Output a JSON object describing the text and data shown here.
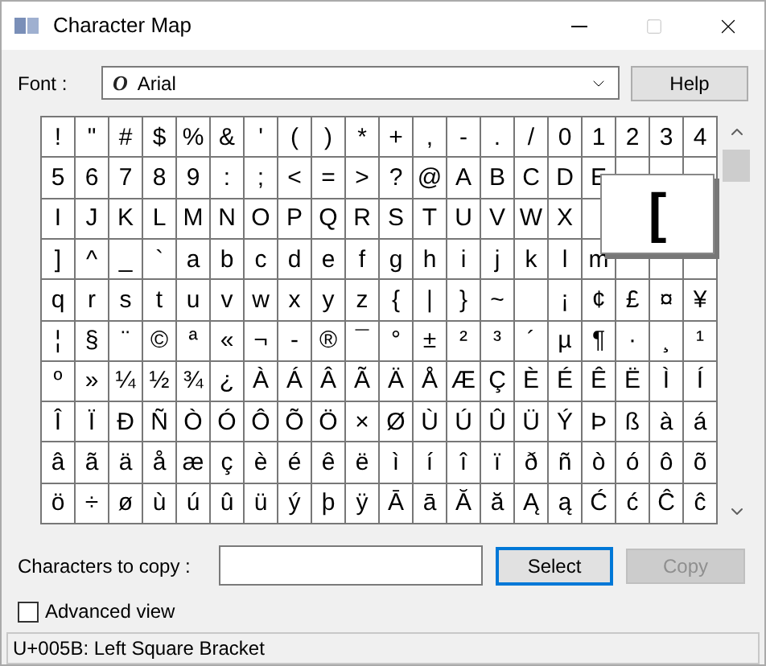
{
  "window": {
    "title": "Character Map"
  },
  "font": {
    "label": "Font :",
    "value": "Arial",
    "glyph": "O"
  },
  "help_button": "Help",
  "grid": [
    [
      "!",
      "\"",
      "#",
      "$",
      "%",
      "&",
      "'",
      "(",
      ")",
      "*",
      "+",
      ",",
      "-",
      ".",
      "/",
      "0",
      "1",
      "2",
      "3",
      "4"
    ],
    [
      "5",
      "6",
      "7",
      "8",
      "9",
      ":",
      ";",
      "<",
      "=",
      ">",
      "?",
      "@",
      "A",
      "B",
      "C",
      "D",
      "E",
      {
        "kind": "empty"
      },
      {
        "kind": "empty"
      },
      {
        "kind": "empty"
      }
    ],
    [
      "I",
      "J",
      "K",
      "L",
      "M",
      "N",
      "O",
      "P",
      "Q",
      "R",
      "S",
      "T",
      "U",
      "V",
      "W",
      "X",
      {
        "kind": "empty"
      }
    ],
    [
      "]",
      "^",
      "_",
      "`",
      "a",
      "b",
      "c",
      "d",
      "e",
      "f",
      "g",
      "h",
      "i",
      "j",
      "k",
      "l",
      "m",
      {
        "kind": "empty"
      },
      {
        "kind": "empty"
      },
      {
        "kind": "empty"
      }
    ],
    [
      "q",
      "r",
      "s",
      "t",
      "u",
      "v",
      "w",
      "x",
      "y",
      "z",
      "{",
      "|",
      "}",
      "~",
      {
        "kind": "empty"
      },
      "¡",
      "¢",
      "£",
      "¤",
      "¥"
    ],
    [
      "¦",
      "§",
      "¨",
      "©",
      "ª",
      "«",
      "¬",
      "-",
      "®",
      "¯",
      "°",
      "±",
      "²",
      "³",
      "´",
      "µ",
      "¶",
      "·",
      "¸",
      "¹"
    ],
    [
      "º",
      "»",
      "¼",
      "½",
      "¾",
      "¿",
      "À",
      "Á",
      "Â",
      "Ã",
      "Ä",
      "Å",
      "Æ",
      "Ç",
      "È",
      "É",
      "Ê",
      "Ë",
      "Ì",
      "Í"
    ],
    [
      "Î",
      "Ï",
      "Ð",
      "Ñ",
      "Ò",
      "Ó",
      "Ô",
      "Õ",
      "Ö",
      "×",
      "Ø",
      "Ù",
      "Ú",
      "Û",
      "Ü",
      "Ý",
      "Þ",
      "ß",
      "à",
      "á"
    ],
    [
      "â",
      "ã",
      "ä",
      "å",
      "æ",
      "ç",
      "è",
      "é",
      "ê",
      "ë",
      "ì",
      "í",
      "î",
      "ï",
      "ð",
      "ñ",
      "ò",
      "ó",
      "ô",
      "õ"
    ],
    [
      "ö",
      "÷",
      "ø",
      "ù",
      "ú",
      "û",
      "ü",
      "ý",
      "þ",
      "ÿ",
      "Ā",
      "ā",
      "Ă",
      "ă",
      "Ą",
      "ą",
      "Ć",
      "ć",
      "Ĉ",
      "ĉ"
    ]
  ],
  "magnified": "[",
  "copy_field": {
    "label": "Characters to copy :"
  },
  "select_button": {
    "label": "Select",
    "focused": true
  },
  "copy_button": {
    "label": "Copy",
    "disabled": true
  },
  "advanced_view": {
    "label": "Advanced view",
    "checked": false
  },
  "status_bar": "U+005B: Left Square Bracket"
}
